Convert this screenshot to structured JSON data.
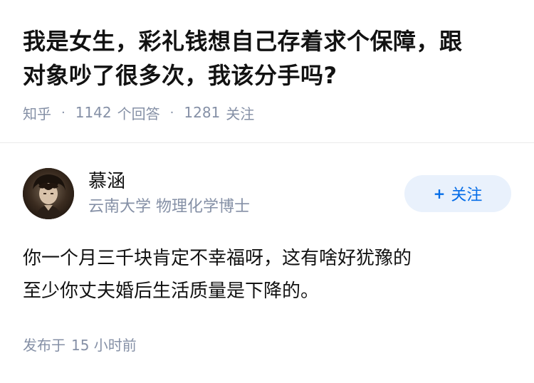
{
  "question": {
    "title_line1": "我是女生，彩礼钱想自己存着求个保障，跟",
    "title_line2": "对象吵了很多次，我该分手吗?",
    "source": "知乎",
    "answer_count": "1142",
    "answer_label": "个回答",
    "follow_count": "1281",
    "follow_label": "关注"
  },
  "author": {
    "name": "慕涵",
    "bio": "云南大学 物理化学博士",
    "avatar_icon": "avatar-portrait"
  },
  "follow_button": {
    "plus": "+",
    "label": "关注"
  },
  "answer": {
    "line1": "你一个月三千块肯定不幸福呀，这有啥好犹豫的",
    "line2": "至少你丈夫婚后生活质量是下降的。"
  },
  "meta": {
    "published_label": "发布于",
    "published_time": "15 小时前"
  },
  "colors": {
    "accent": "#056de8",
    "accent_bg": "#e9f1fc",
    "muted": "#8590a6",
    "text": "#121212"
  }
}
